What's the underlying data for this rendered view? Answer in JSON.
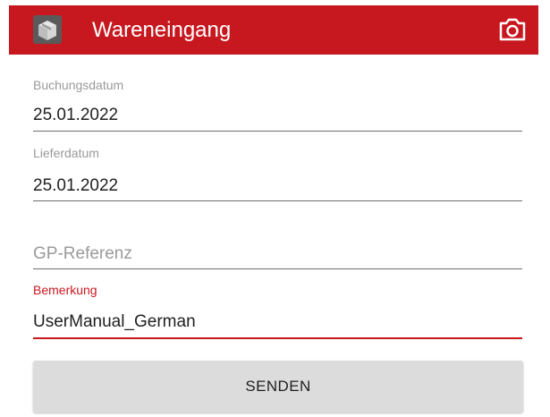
{
  "toolbar": {
    "title": "Wareneingang",
    "app_icon": "box-icon",
    "camera_icon": "camera-icon",
    "background_color": "#c8181f"
  },
  "form": {
    "buchungsdatum": {
      "label": "Buchungsdatum",
      "value": "25.01.2022"
    },
    "lieferdatum": {
      "label": "Lieferdatum",
      "value": "25.01.2022"
    },
    "gp_referenz": {
      "placeholder": "GP-Referenz"
    },
    "bemerkung": {
      "label": "Bemerkung",
      "value": "UserManual_German"
    }
  },
  "actions": {
    "send_label": "SENDEN"
  }
}
